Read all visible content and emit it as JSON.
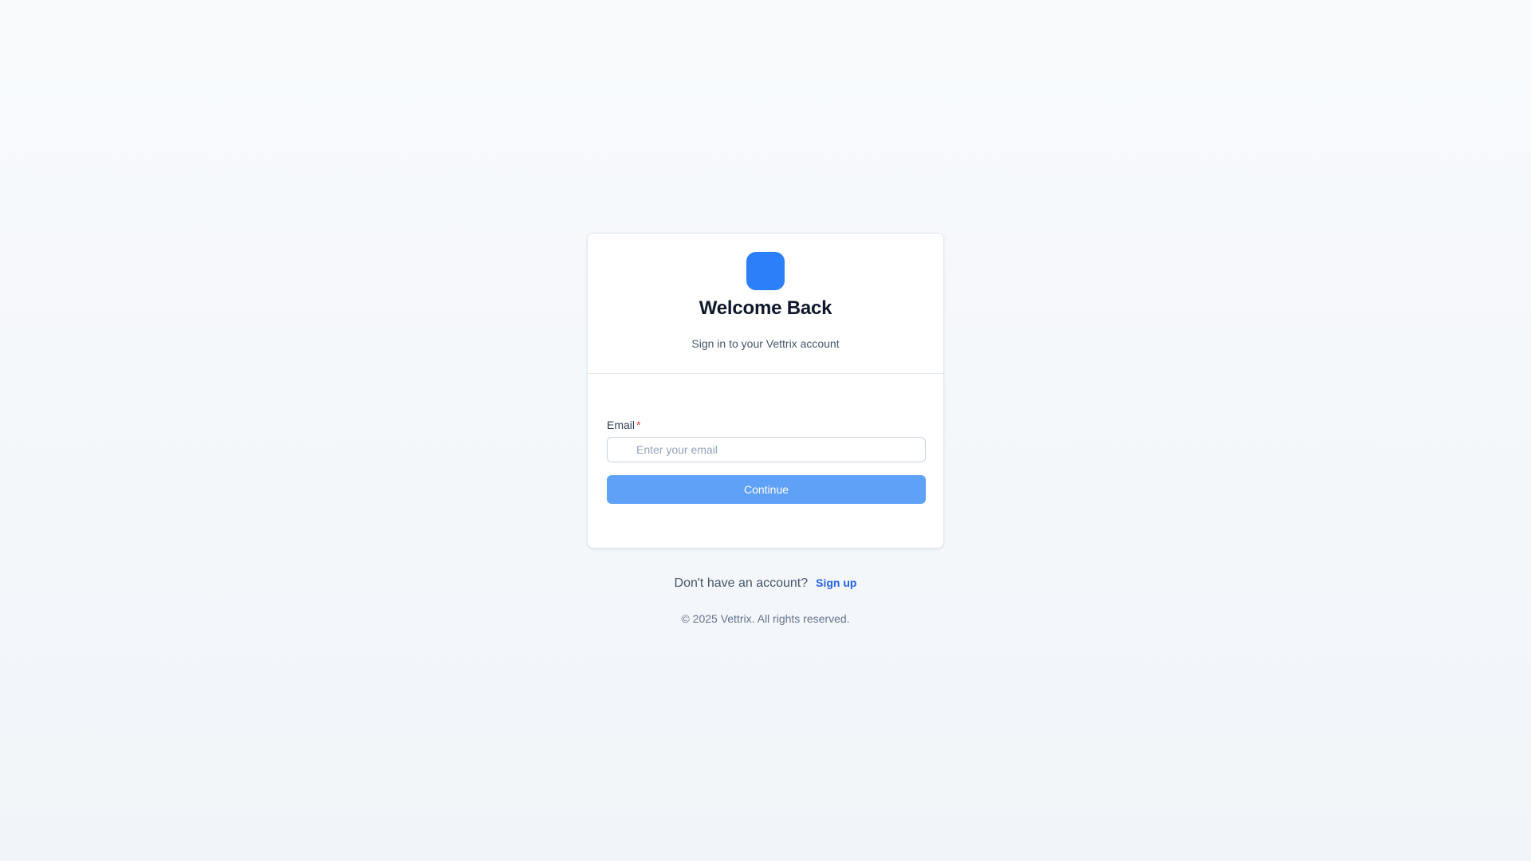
{
  "colors": {
    "accent": "#2d7ff9",
    "button": "#60a1f8",
    "link": "#2563eb",
    "required": "#ef4444"
  },
  "header": {
    "logo_icon": "app-logo-icon",
    "title": "Welcome Back",
    "subtitle": "Sign in to your Vettrix account"
  },
  "form": {
    "email_label": "Email",
    "required_marker": "*",
    "email_icon": "mail-icon",
    "email_value": "",
    "email_placeholder": "Enter your email",
    "continue_label": "Continue"
  },
  "signup": {
    "prompt": "Don't have an account?",
    "link_label": "Sign up"
  },
  "footer": {
    "copyright": "© 2025 Vettrix. All rights reserved."
  }
}
